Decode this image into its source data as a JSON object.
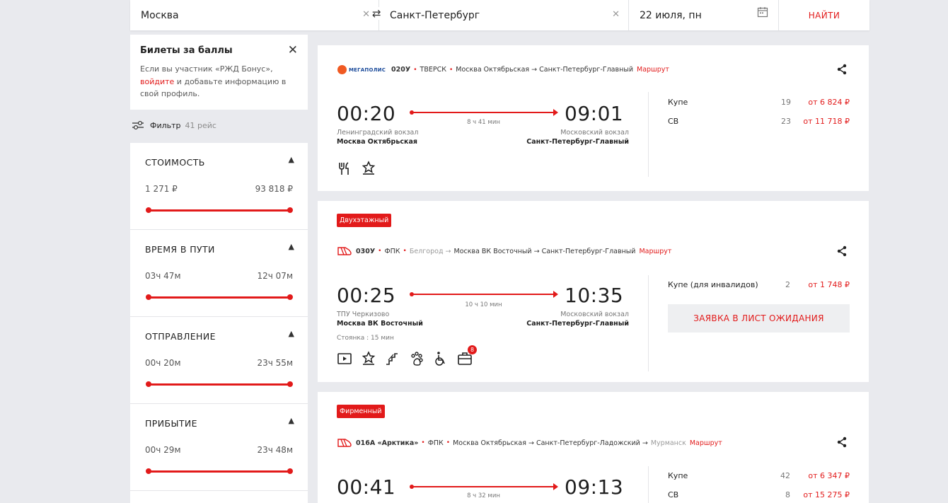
{
  "search": {
    "from": "Москва",
    "to": "Санкт-Петербург",
    "date": "22 июля, пн",
    "find_label": "НАЙТИ"
  },
  "bonus": {
    "title": "Билеты за баллы",
    "text_before": "Если вы участник «РЖД Бонус»,",
    "link": "войдите",
    "text_after": " и добавьте информацию в свой профиль."
  },
  "filter": {
    "label": "Фильтр",
    "count": "41 рейс"
  },
  "filter_sections": [
    {
      "title": "СТОИМОСТЬ",
      "min": "1 271 ₽",
      "max": "93 818 ₽"
    },
    {
      "title": "ВРЕМЯ В ПУТИ",
      "min": "03ч 47м",
      "max": "12ч 07м"
    },
    {
      "title": "ОТПРАВЛЕНИЕ",
      "min": "00ч 20м",
      "max": "23ч 55м"
    },
    {
      "title": "ПРИБЫТИЕ",
      "min": "00ч 29м",
      "max": "23ч 48м"
    }
  ],
  "trains": [
    {
      "carrier_logo": "МЕГАПОЛИС",
      "number": "020У",
      "carrier": "ТВЕРСК",
      "route": "Москва Октябрьская → Санкт-Петербург-Главный",
      "route_link": "Маршрут",
      "dep_time": "00:20",
      "arr_time": "09:01",
      "duration": "8 ч 41 мин",
      "dep_station": "Ленинградский вокзал",
      "dep_city": "Москва Октябрьская",
      "arr_station": "Московский вокзал",
      "arr_city": "Санкт-Петербург-Главный",
      "seats": [
        {
          "class": "Купе",
          "qty": "19",
          "price": "от 6 824 ₽"
        },
        {
          "class": "СВ",
          "qty": "23",
          "price": "от 11 718 ₽"
        }
      ]
    },
    {
      "badge": "Двухэтажный",
      "number": "030У",
      "carrier": "ФПК",
      "route_origin": "Белгород →",
      "route": "Москва ВК Восточный → Санкт-Петербург-Главный",
      "route_link": "Маршрут",
      "dep_time": "00:25",
      "arr_time": "10:35",
      "duration": "10 ч 10 мин",
      "dep_station": "ТПУ Черкизово",
      "dep_city": "Москва ВК Восточный",
      "arr_station": "Московский вокзал",
      "arr_city": "Санкт-Петербург-Главный",
      "stop": "Стоянка : 15 мин",
      "luggage_count": "8",
      "seats": [
        {
          "class": "Купе (для инвалидов)",
          "qty": "2",
          "price": "от 1 748 ₽"
        }
      ],
      "wait_label": "ЗАЯВКА В ЛИСТ ОЖИДАНИЯ"
    },
    {
      "badge": "Фирменный",
      "number": "016А «Арктика»",
      "carrier": "ФПК",
      "route": "Москва Октябрьская → Санкт-Петербург-Ладожский →",
      "route_dest": "Мурманск",
      "route_link": "Маршрут",
      "dep_time": "00:41",
      "arr_time": "09:13",
      "duration": "8 ч 32 мин",
      "seats": [
        {
          "class": "Купе",
          "qty": "42",
          "price": "от 6 347 ₽"
        },
        {
          "class": "СВ",
          "qty": "8",
          "price": "от 15 275 ₽"
        }
      ]
    }
  ],
  "colors": {
    "accent": "#e21a1a",
    "background": "#e9eaee"
  }
}
